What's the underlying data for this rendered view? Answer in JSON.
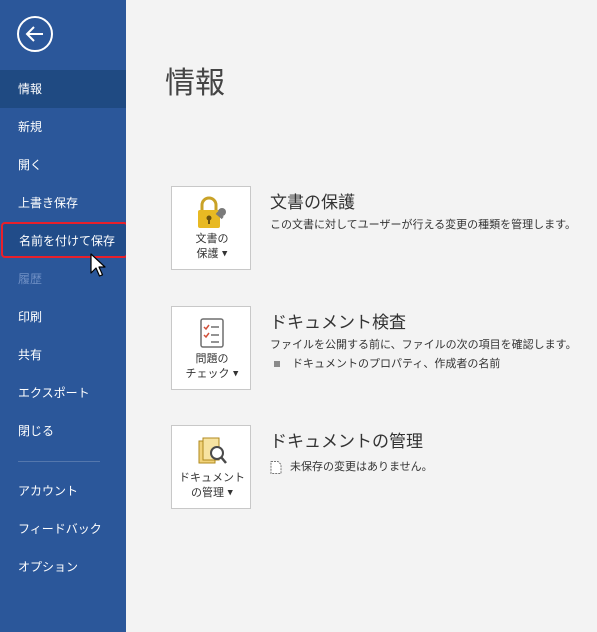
{
  "sidebar": {
    "back_icon": "back-arrow-icon",
    "items": [
      {
        "label": "情報",
        "state": "active"
      },
      {
        "label": "新規"
      },
      {
        "label": "開く"
      },
      {
        "label": "上書き保存"
      },
      {
        "label": "名前を付けて保存",
        "state": "highlighted"
      },
      {
        "label": "履歴",
        "state": "disabled"
      },
      {
        "label": "印刷"
      },
      {
        "label": "共有"
      },
      {
        "label": "エクスポート"
      },
      {
        "label": "閉じる"
      },
      {
        "label": "アカウント"
      },
      {
        "label": "フィードバック"
      },
      {
        "label": "オプション"
      }
    ]
  },
  "main": {
    "title": "情報",
    "sections": [
      {
        "tile_icon": "lock-key-icon",
        "tile_label_line1": "文書の",
        "tile_label_line2": "保護",
        "title": "文書の保護",
        "description": "この文書に対してユーザーが行える変更の種類を管理します。"
      },
      {
        "tile_icon": "checklist-icon",
        "tile_label_line1": "問題の",
        "tile_label_line2": "チェック",
        "title": "ドキュメント検査",
        "description": "ファイルを公開する前に、ファイルの次の項目を確認します。",
        "bullet": "ドキュメントのプロパティ、作成者の名前"
      },
      {
        "tile_icon": "search-document-icon",
        "tile_label_line1": "ドキュメント",
        "tile_label_line2": "の管理",
        "title": "ドキュメントの管理",
        "note": "未保存の変更はありません。",
        "note_icon": "document-icon"
      }
    ]
  },
  "colors": {
    "sidebar_bg": "#2b579a",
    "sidebar_active_bg": "#1f4a82",
    "highlight_border": "#e8202a",
    "main_bg": "#f3f3f3"
  }
}
